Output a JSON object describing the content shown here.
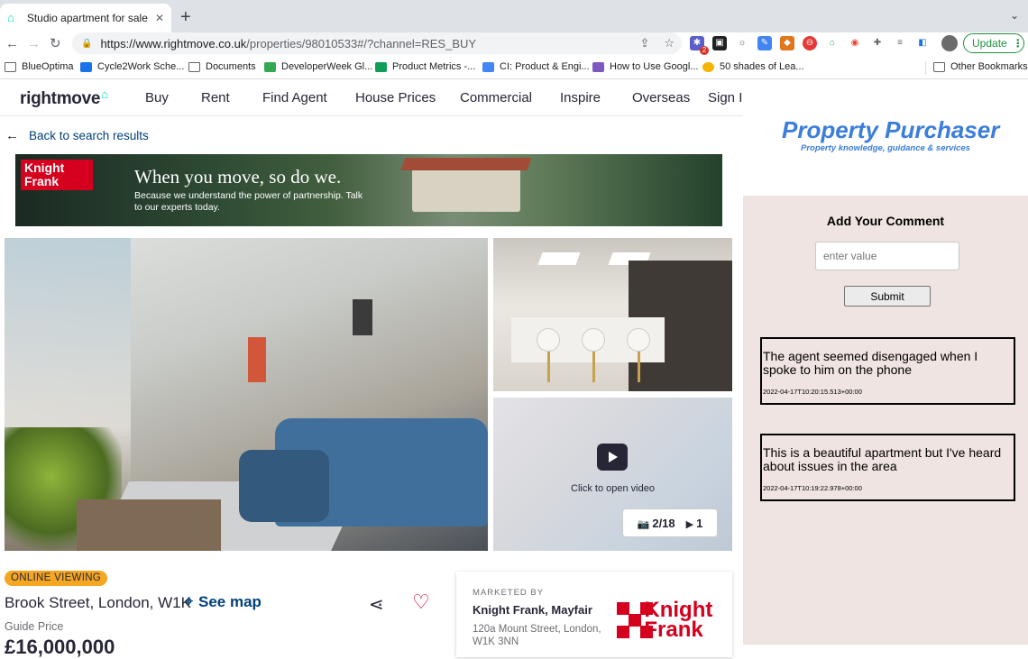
{
  "browser": {
    "tab_title": "Studio apartment for sale in Br",
    "url_host": "https://www.rightmove.co.uk",
    "url_path": "/properties/98010533#/?channel=RES_BUY",
    "update_label": "Update",
    "ext_badge": "2"
  },
  "bookmarks": [
    {
      "label": "BlueOptima",
      "icon": "folder-icon"
    },
    {
      "label": "Cycle2Work Sche...",
      "icon": "site-icon",
      "color": "#1a73e8"
    },
    {
      "label": "Documents",
      "icon": "folder-icon"
    },
    {
      "label": "DeveloperWeek Gl...",
      "icon": "site-icon",
      "color": "#34a853"
    },
    {
      "label": "Product Metrics -...",
      "icon": "site-icon",
      "color": "#0f9d58"
    },
    {
      "label": "CI: Product & Engi...",
      "icon": "site-icon",
      "color": "#4285f4"
    },
    {
      "label": "How to Use Googl...",
      "icon": "site-icon",
      "color": "#7e57c2"
    },
    {
      "label": "50 shades of Lea...",
      "icon": "site-icon",
      "color": "#f4b400"
    },
    {
      "label": "Other Bookmarks",
      "icon": "folder-icon"
    }
  ],
  "site": {
    "logo_text": "rightmove",
    "nav": [
      "Buy",
      "Rent",
      "Find Agent",
      "House Prices",
      "Commercial",
      "Inspire",
      "Overseas",
      "Sign In"
    ],
    "back_label": "Back to search results"
  },
  "banner": {
    "brand": "Knight Frank",
    "headline": "When you move, so do we.",
    "subline": "Because we understand the power of partnership. Talk to our experts today."
  },
  "gallery": {
    "video_caption": "Click to open video",
    "photo_count": "2/18",
    "video_count": "1"
  },
  "listing": {
    "badge": "ONLINE VIEWING",
    "address": "Brook Street, London, W1K",
    "see_map": "See map",
    "price_label": "Guide Price",
    "price": "£16,000,000"
  },
  "agent": {
    "marketed_by": "MARKETED BY",
    "name": "Knight Frank, Mayfair",
    "address": "120a Mount Street, London, W1K 3NN",
    "logo_text": "Knight Frank",
    "brand_color": "#d4001e"
  },
  "comments_panel": {
    "brand_title": "Property Purchaser",
    "brand_subtitle": "Property knowledge, guidance & services",
    "heading": "Add Your Comment",
    "input_placeholder": "enter value",
    "submit_label": "Submit",
    "comments": [
      {
        "text": "The agent seemed disengaged when I spoke to him on the phone",
        "timestamp": "2022-04-17T10:20:15.513+00:00"
      },
      {
        "text": "This is a beautiful apartment but I've heard about issues in the area",
        "timestamp": "2022-04-17T10:19:22.978+00:00"
      }
    ]
  },
  "colors": {
    "rightmove_teal": "#00deb6",
    "link_blue": "#00407a",
    "badge_orange": "#f5a623",
    "panel_bg": "#efe4e1",
    "property_purchaser_blue": "#3b7ddd"
  }
}
